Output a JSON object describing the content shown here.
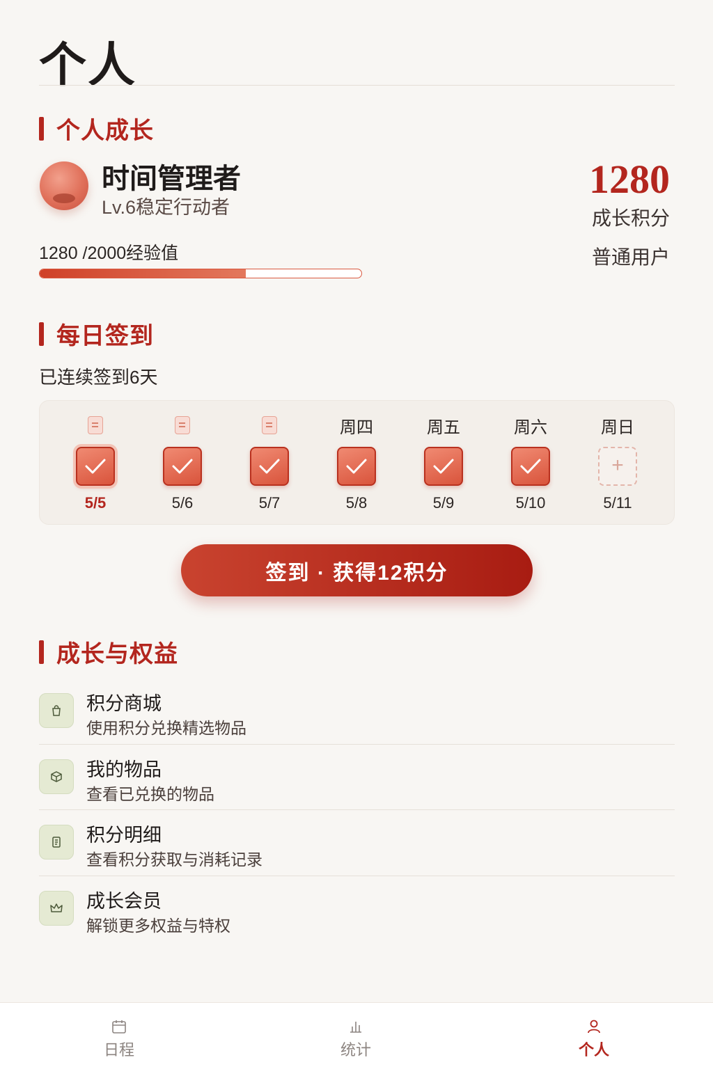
{
  "page": {
    "title": "个人"
  },
  "growth": {
    "section_title": "个人成长",
    "user_name": "时间管理者",
    "level": "Lv.6稳定行动者",
    "score": "1280",
    "score_label": "成长积分",
    "tier": "普通用户",
    "exp_text": "1280 /2000经验值",
    "exp_progress": 0.64
  },
  "checkin": {
    "section_title": "每日签到",
    "streak": "已连续签到6天",
    "days": [
      {
        "head": "",
        "date": "5/5",
        "checked": true,
        "today": true
      },
      {
        "head": "",
        "date": "5/6",
        "checked": true,
        "today": false
      },
      {
        "head": "",
        "date": "5/7",
        "checked": true,
        "today": false
      },
      {
        "head": "周四",
        "date": "5/8",
        "checked": true,
        "today": false
      },
      {
        "head": "周五",
        "date": "5/9",
        "checked": true,
        "today": false
      },
      {
        "head": "周六",
        "date": "5/10",
        "checked": true,
        "today": false
      },
      {
        "head": "周日",
        "date": "5/11",
        "checked": false,
        "today": false
      }
    ],
    "button_label": "签到 · 获得12积分"
  },
  "benefits": {
    "section_title": "成长与权益",
    "items": [
      {
        "title": "积分商城",
        "subtitle": "使用积分兑换精选物品",
        "icon": "shopping-bag-icon"
      },
      {
        "title": "我的物品",
        "subtitle": "查看已兑换的物品",
        "icon": "box-icon"
      },
      {
        "title": "积分明细",
        "subtitle": "查看积分获取与消耗记录",
        "icon": "receipt-icon"
      },
      {
        "title": "成长会员",
        "subtitle": "解锁更多权益与特权",
        "icon": "crown-icon"
      }
    ]
  },
  "nav": {
    "items": [
      {
        "label": "日程",
        "icon": "calendar-icon",
        "active": false
      },
      {
        "label": "统计",
        "icon": "chart-icon",
        "active": false
      },
      {
        "label": "个人",
        "icon": "person-icon",
        "active": true
      }
    ]
  },
  "colors": {
    "accent": "#b3261e",
    "background": "#f8f6f3",
    "icon_bg": "#e5ead3"
  }
}
